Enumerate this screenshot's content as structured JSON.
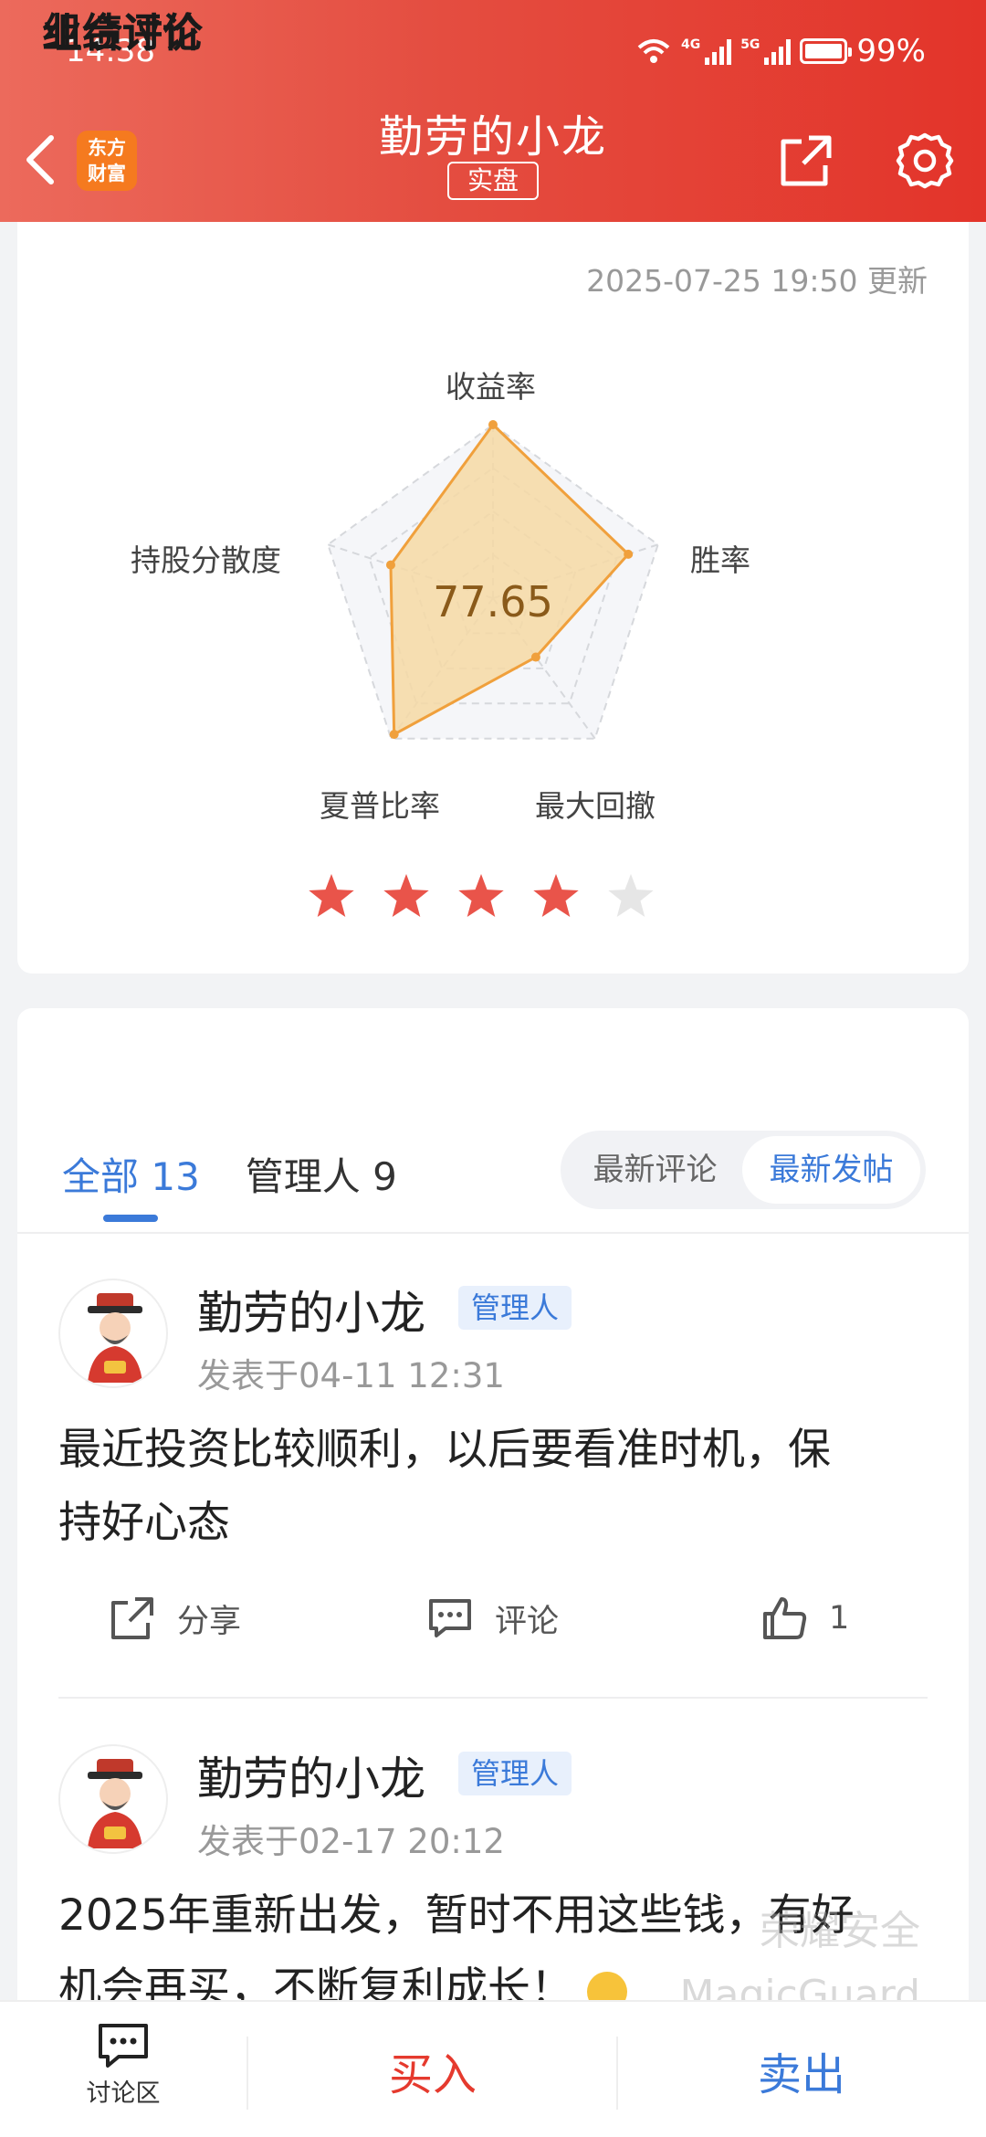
{
  "status_bar": {
    "time": "14:38",
    "net1": "4G",
    "net2": "5G",
    "battery": "99%"
  },
  "header": {
    "logo": "东方\n财富",
    "logo_line1": "东方",
    "logo_line2": "财富",
    "title": "勤劳的小龙",
    "tag": "实盘"
  },
  "performance": {
    "title": "业绩评价",
    "updated": "2025-07-25 19:50 更新",
    "score": "77.65",
    "axes": [
      "收益率",
      "胜率",
      "最大回撤",
      "夏普比率",
      "持股分散度"
    ],
    "axis_values": [
      1.0,
      0.82,
      0.42,
      0.97,
      0.62
    ],
    "stars_filled": 4,
    "stars_total": 5
  },
  "discussion": {
    "title": "组合讨论",
    "tabs": [
      {
        "label": "全部 13"
      },
      {
        "label": "管理人 9"
      }
    ],
    "sort": {
      "latest_comment": "最新评论",
      "latest_post": "最新发帖"
    },
    "posts": [
      {
        "author": "勤劳的小龙",
        "badge": "管理人",
        "time": "发表于04-11 12:31",
        "line1": "最近投资比较顺利，以后要看准时机，保",
        "line2": "持好心态",
        "share": "分享",
        "comment": "评论",
        "likes": "1"
      },
      {
        "author": "勤劳的小龙",
        "badge": "管理人",
        "time": "发表于02-17 20:12",
        "line1": "2025年重新出发，暂时不用这些钱，有好",
        "line2": "机会再买，不断复利成长！"
      }
    ]
  },
  "watermark": {
    "line1": "荣耀安全",
    "line2": "MagicGuard"
  },
  "bottom_bar": {
    "discussion": "讨论区",
    "buy": "买入",
    "sell": "卖出"
  },
  "colors": {
    "header_red": "#e44d40",
    "accent_blue": "#3b7ad9",
    "star_red": "#e9544a",
    "radar_fill": "#f6d9a5",
    "radar_stroke": "#f0a03c"
  }
}
